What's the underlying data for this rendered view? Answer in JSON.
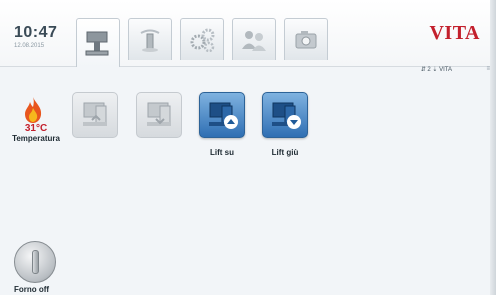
{
  "header": {
    "time": "10:47",
    "date": "12.08.2015",
    "logo": "VITA",
    "tabs": [
      {
        "icon": "furnace-icon",
        "active": true
      },
      {
        "icon": "tools-icon",
        "active": false
      },
      {
        "icon": "settings-gears-icon",
        "active": false
      },
      {
        "icon": "users-icon",
        "active": false
      },
      {
        "icon": "camera-icon",
        "active": false
      }
    ],
    "status": "⇵ 2  ⇣ VITA",
    "status_extra": "≡"
  },
  "temperature": {
    "icon": "flame-icon",
    "value": "31°C",
    "label": "Temperatura"
  },
  "buttons": [
    {
      "icon": "lift-disabled-icon",
      "label": "",
      "enabled": false
    },
    {
      "icon": "lift-disabled-icon",
      "label": "",
      "enabled": false
    },
    {
      "icon": "lift-up-icon",
      "label": "Lift su",
      "enabled": true
    },
    {
      "icon": "lift-down-icon",
      "label": "Lift giù",
      "enabled": true
    }
  ],
  "power": {
    "icon": "power-icon",
    "label": "Forno off"
  },
  "colors": {
    "brand": "#c3202d",
    "accent": "#2f6fb3",
    "text": "#1e2a32"
  }
}
